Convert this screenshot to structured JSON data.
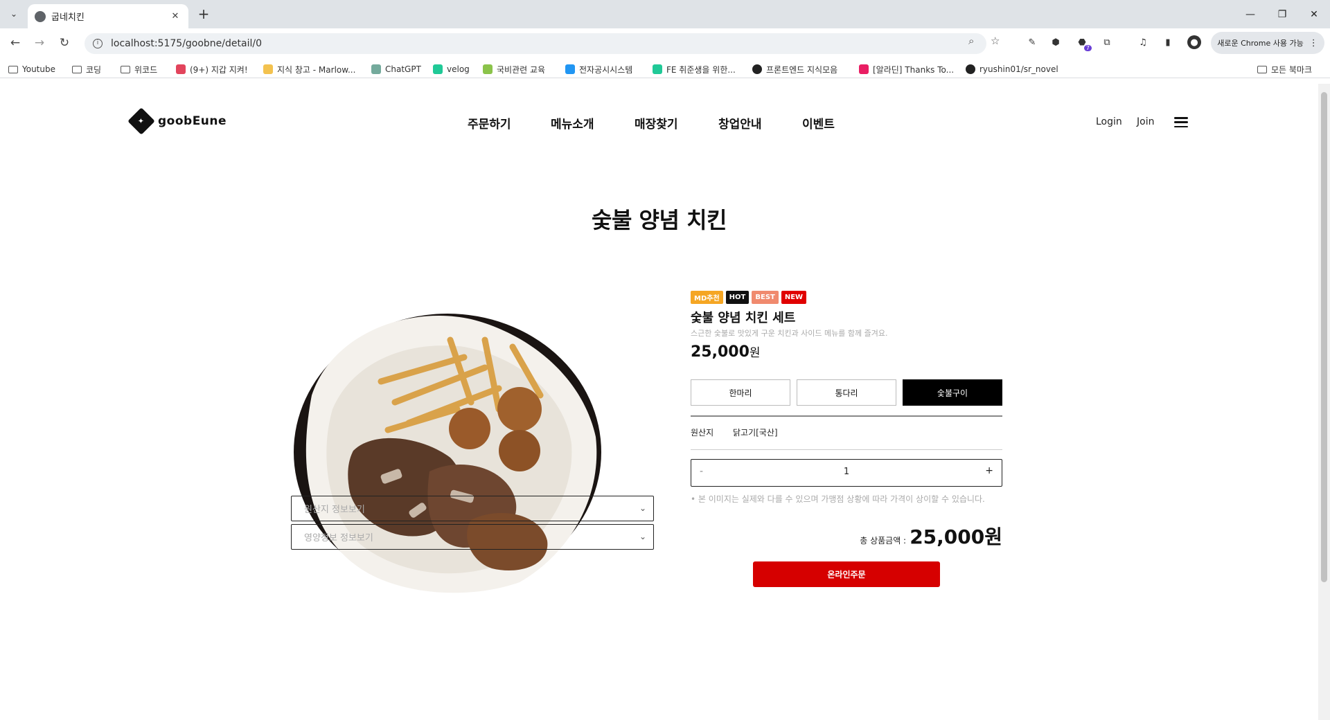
{
  "browser": {
    "tab_title": "굽네치킨",
    "tab_close": "✕",
    "new_tab": "+",
    "tab_menu": "⌄",
    "window_controls": [
      "—",
      "❐",
      "✕"
    ],
    "url": "localhost:5175/goobne/detail/0",
    "profile_label": "새로운 Chrome 사용 가능",
    "extension_badge": "7",
    "bookmarks": [
      {
        "label": "Youtube",
        "icon": "folder-icon"
      },
      {
        "label": "코딩",
        "icon": "folder-icon"
      },
      {
        "label": "위코드",
        "icon": "folder-icon"
      },
      {
        "label": "(9+) 지갑 지켜!",
        "icon": "site-icon",
        "color": "#e2445c"
      },
      {
        "label": "지식 창고 - Marlow...",
        "icon": "site-icon",
        "color": "#f3c24f"
      },
      {
        "label": "ChatGPT",
        "icon": "site-icon",
        "color": "#74aa9c"
      },
      {
        "label": "velog",
        "icon": "site-icon",
        "color": "#20c997"
      },
      {
        "label": "국비관련 교육",
        "icon": "site-icon",
        "color": "#8bc34a"
      },
      {
        "label": "전자공시시스템",
        "icon": "site-icon",
        "color": "#2196f3"
      },
      {
        "label": "FE 취준생을 위한...",
        "icon": "site-icon",
        "color": "#20c997"
      },
      {
        "label": "프론트엔드 지식모음",
        "icon": "github-icon",
        "color": "#222222"
      },
      {
        "label": "[알라딘] Thanks To...",
        "icon": "site-icon",
        "color": "#e91e63"
      },
      {
        "label": "ryushin01/sr_novel",
        "icon": "github-icon",
        "color": "#222222"
      }
    ],
    "all_bookmarks": "모든 북마크"
  },
  "header": {
    "logo_text": "goobEune",
    "nav": [
      "주문하기",
      "메뉴소개",
      "매장찾기",
      "창업안내",
      "이벤트"
    ],
    "login": "Login",
    "join": "Join"
  },
  "page_title": "숯불 양념 치킨",
  "product": {
    "badges": [
      {
        "label": "MD추천",
        "color": "#f5a623"
      },
      {
        "label": "HOT",
        "color": "#111111"
      },
      {
        "label": "BEST",
        "color": "#f08a6e"
      },
      {
        "label": "NEW",
        "color": "#e00000"
      }
    ],
    "name": "숯불 양념 치킨 세트",
    "description": "스근한 숯불로 맛있게 구운 치킨과 사이드 메뉴를 함께 즐겨요.",
    "price": "25,000",
    "price_unit": "원",
    "options": [
      "한마리",
      "통다리",
      "숯불구이"
    ],
    "selected_option": "숯불구이",
    "origin_label": "원산지",
    "origin_value": "닭고기[국산]",
    "quantity": "1",
    "minus": "-",
    "plus": "+",
    "notice": "• 본 이미지는 실제와 다를 수 있으며 가맹점 상황에 따라 가격이 상이할 수 있습니다.",
    "total_label": "총 상품금액 :",
    "total_amount": "25,000원",
    "order_button": "온라인주문"
  },
  "accordions": [
    "원산지 정보보기",
    "영양정보 정보보기"
  ],
  "colors": {
    "brand_red": "#d60000",
    "selected_option_bg": "#000000"
  }
}
